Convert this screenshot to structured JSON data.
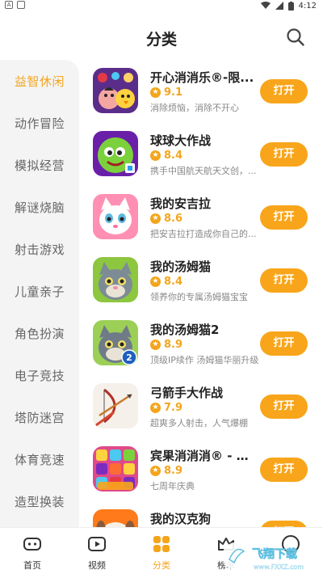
{
  "status_bar": {
    "time": "4:12",
    "icons": [
      "notification-a-icon",
      "notification-box-icon",
      "wifi-icon",
      "signal-icon",
      "battery-icon"
    ]
  },
  "header": {
    "title": "分类",
    "search_icon": "search-icon"
  },
  "sidebar": {
    "items": [
      {
        "label": "益智休闲",
        "active": true
      },
      {
        "label": "动作冒险"
      },
      {
        "label": "模拟经营"
      },
      {
        "label": "解谜烧脑"
      },
      {
        "label": "射击游戏"
      },
      {
        "label": "儿童亲子"
      },
      {
        "label": "角色扮演"
      },
      {
        "label": "电子竞技"
      },
      {
        "label": "塔防迷宫"
      },
      {
        "label": "体育竞速"
      },
      {
        "label": "造型换装"
      }
    ]
  },
  "games": [
    {
      "name": "开心消消乐®-限...",
      "score": "9.1",
      "desc": "消除烦恼，消除不开心",
      "button": "打开",
      "icon": "happy-match-game-icon"
    },
    {
      "name": "球球大作战",
      "score": "8.4",
      "desc": "携手中国航天航天文创，...",
      "button": "打开",
      "icon": "ball-battle-game-icon"
    },
    {
      "name": "我的安吉拉",
      "score": "8.6",
      "desc": "把安吉拉打造成你自己的...",
      "button": "打开",
      "icon": "angela-cat-game-icon"
    },
    {
      "name": "我的汤姆猫",
      "score": "8.4",
      "desc": "领养你的专属汤姆猫宝宝",
      "button": "打开",
      "icon": "tom-cat-game-icon"
    },
    {
      "name": "我的汤姆猫2",
      "score": "8.9",
      "desc": "顶级IP续作 汤姆猫华丽升级",
      "button": "打开",
      "icon": "tom-cat-2-game-icon"
    },
    {
      "name": "弓箭手大作战",
      "score": "7.9",
      "desc": "超爽多人射击，人气爆棚",
      "button": "打开",
      "icon": "archer-game-icon"
    },
    {
      "name": "宾果消消消® - 3...",
      "score": "8.9",
      "desc": "七周年庆典",
      "button": "打开",
      "icon": "bingo-match-game-icon"
    },
    {
      "name": "我的汉克狗",
      "score": "",
      "desc": "",
      "button": "打开",
      "icon": "hank-dog-game-icon"
    }
  ],
  "tabbar": {
    "tabs": [
      {
        "label": "首页",
        "icon": "gamepad-icon"
      },
      {
        "label": "视频",
        "icon": "video-play-icon"
      },
      {
        "label": "分类",
        "icon": "category-grid-icon",
        "active": true
      },
      {
        "label": "榜单",
        "icon": "crown-icon"
      },
      {
        "label": "",
        "icon": "profile-icon"
      }
    ]
  },
  "watermark": {
    "text": "飞翔下载",
    "url_text": "www.FXXZ.com"
  },
  "colors": {
    "accent": "#f4a51c",
    "button": "#f8a51b",
    "sidebar_bg": "#f4f4f4"
  }
}
